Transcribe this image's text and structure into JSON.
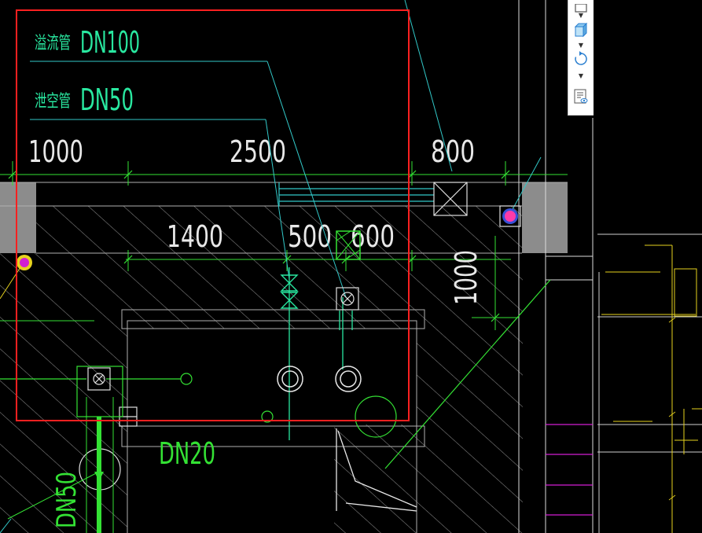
{
  "labels": {
    "overflow_pipe_name": "溢流管",
    "overflow_pipe_size": "DN100",
    "vent_pipe_name": "泄空管",
    "vent_pipe_size": "DN50",
    "dn20": "DN20",
    "dn50_vertical": "DN50"
  },
  "dimensions": {
    "d1000": "1000",
    "d2500": "2500",
    "d800": "800",
    "d1400": "1400",
    "d500": "500",
    "d600": "600",
    "d1000_vertical": "1000"
  },
  "colors": {
    "background": "#000000",
    "label_green": "#29e8a0",
    "dim_white": "#e8e8e8",
    "dim_green": "#34e234",
    "hatch": "#9a9a9a",
    "red_box": "#ff2020",
    "cyan": "#32c8c8",
    "magenta": "#d21ed2",
    "yellow_green": "#b4dc28",
    "gray_block": "#8c8c8c"
  },
  "toolbar": {
    "icons": [
      "window-icon",
      "cube-icon",
      "rotate-icon",
      "properties-icon"
    ]
  }
}
